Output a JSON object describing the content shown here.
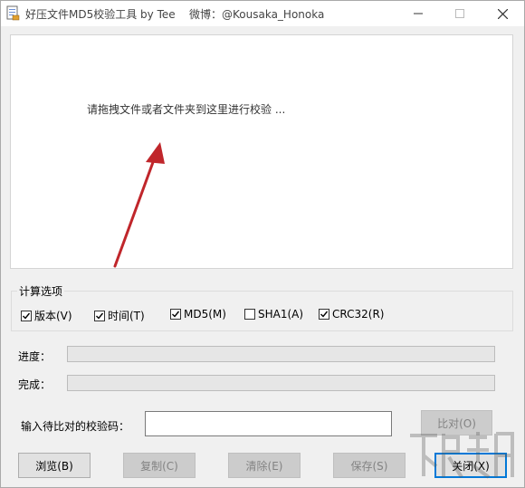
{
  "window": {
    "title": "好压文件MD5校验工具 by Tee",
    "weibo": "微博：@Kousaka_Honoka"
  },
  "drop_area": {
    "hint": "请拖拽文件或者文件夹到这里进行校验 ..."
  },
  "options": {
    "legend": "计算选项",
    "items": [
      {
        "label": "版本(V)",
        "checked": true
      },
      {
        "label": "时间(T)",
        "checked": true
      },
      {
        "label": "MD5(M)",
        "checked": true
      },
      {
        "label": "SHA1(A)",
        "checked": false
      },
      {
        "label": "CRC32(R)",
        "checked": true
      }
    ]
  },
  "progress": {
    "label": "进度：",
    "value": 0
  },
  "complete": {
    "label": "完成：",
    "value": 0
  },
  "compare": {
    "label": "输入待比对的校验码：",
    "value": "",
    "button": "比对(O)"
  },
  "buttons": {
    "browse": "浏览(B)",
    "copy": "复制(C)",
    "clear": "清除(E)",
    "save": "保存(S)",
    "close": "关闭(X)"
  },
  "colors": {
    "arrow": "#c0262b",
    "focus_border": "#0078d7"
  },
  "icons": {
    "app": "document-icon",
    "minimize": "minimize-icon",
    "maximize": "maximize-icon",
    "close": "close-icon",
    "check": "check-icon"
  }
}
